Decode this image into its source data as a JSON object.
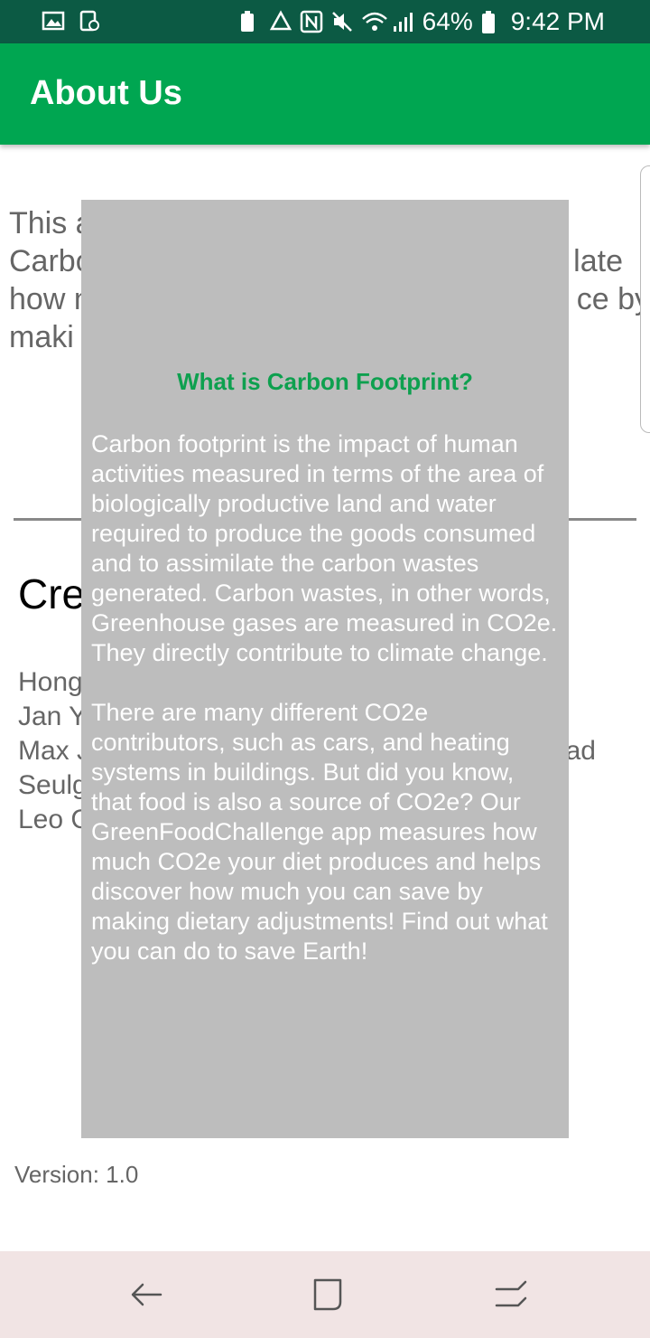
{
  "status_bar": {
    "battery": "64%",
    "time": "9:42 PM"
  },
  "app_bar": {
    "title": "About Us"
  },
  "page": {
    "intro": "This app was made to help you calculate how much Carbon you can reduce by making changes to your diet. Calculate how much Carbon you can reduce by making",
    "intro_visible": [
      "This a",
      "Carbo",
      "how n",
      "maki"
    ],
    "intro_right": [
      "late",
      "ce by"
    ],
    "credits_heading": "Cre",
    "credits": [
      "Hong",
      "Jan Y",
      "Max J",
      "Seulg",
      "Leo C"
    ],
    "credits_right": "ad",
    "version": "Version: 1.0"
  },
  "popup": {
    "title": "What is Carbon Footprint?",
    "body": "Carbon footprint is the impact of human activities measured in terms of the area of biologically productive land and water required to produce the goods consumed and to assimilate the carbon wastes generated. Carbon wastes, in other words, Greenhouse gases are measured in CO2e. They directly contribute to climate change.\n\n There are many different CO2e contributors, such as cars, and heating systems in buildings. But did you know, that food is also a source of CO2e? Our GreenFoodChallenge app measures how much CO2e your diet produces and helps discover how much you can save by making dietary adjustments! Find out what you can do to save Earth!"
  },
  "colors": {
    "status_bar": "#0c5a44",
    "app_bar": "#00a651",
    "popup_bg": "#bdbdbd",
    "popup_title": "#0ea04f",
    "nav_bar": "#f1e4e4"
  },
  "icons": {
    "status_left": [
      "image-icon",
      "screenshot-icon"
    ],
    "status_right": [
      "battery-saver-icon",
      "recycle-icon",
      "nfc-icon",
      "mute-icon",
      "wifi-icon",
      "signal-icon",
      "battery-icon"
    ],
    "nav": [
      "back-icon",
      "recents-icon",
      "home-switch-icon"
    ]
  }
}
